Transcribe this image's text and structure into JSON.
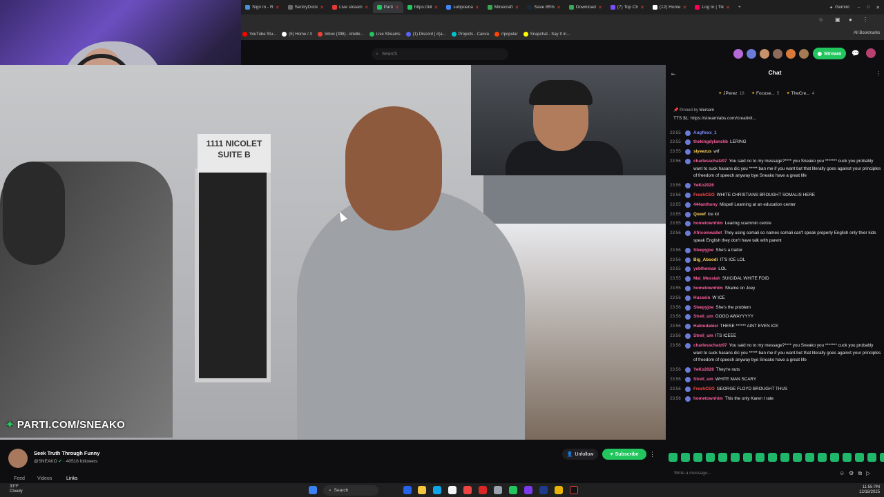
{
  "browser": {
    "tabs": [
      {
        "label": "Sign In - R",
        "color": "#4a90d9"
      },
      {
        "label": "SentryDock",
        "color": "#6b6b6b"
      },
      {
        "label": "Live stream",
        "color": "#e53935"
      },
      {
        "label": "Parti",
        "color": "#22c55e",
        "active": true
      },
      {
        "label": "https://kil",
        "color": "#22c55e"
      },
      {
        "label": "subpoena",
        "color": "#4285f4"
      },
      {
        "label": "Minecraft",
        "color": "#3aa757"
      },
      {
        "label": "Save 85%",
        "color": "#1b2838"
      },
      {
        "label": "Download",
        "color": "#3aa757"
      },
      {
        "label": "(7) Top Ch",
        "color": "#7c4dff"
      },
      {
        "label": "(12) Home",
        "color": "#ffffff"
      },
      {
        "label": "Log In | Tik",
        "color": "#ff0050"
      }
    ],
    "new_tab_symbol": "+",
    "gemini_label": "Gemini",
    "bookmarks": [
      {
        "label": "YouTube Stu...",
        "color": "#ff0000"
      },
      {
        "label": "(5) Home / X",
        "color": "#ffffff"
      },
      {
        "label": "Inbox (398) - khelle...",
        "color": "#ea4335"
      },
      {
        "label": "Live Streams",
        "color": "#22c55e"
      },
      {
        "label": "(1) Discord | #(a...",
        "color": "#5865f2"
      },
      {
        "label": "Projects - Canva",
        "color": "#00c4cc"
      },
      {
        "label": "r/popular",
        "color": "#ff4500"
      },
      {
        "label": "Snapchat - Say It In...",
        "color": "#fffc00"
      }
    ],
    "all_bookmarks": "All Bookmarks"
  },
  "site": {
    "search_placeholder": "Search",
    "stream_button": "Stream"
  },
  "video": {
    "watermark": "PARTI.COM/SNEAKO",
    "sign_text": "1111 NICOLET SUITE B"
  },
  "stream": {
    "title": "Seek Truth Through Funny",
    "channel": "@SNEAKO",
    "followers": "40516 followers",
    "tabs": [
      "Feed",
      "Videos",
      "Links"
    ],
    "unfollow": "Unfollow",
    "subscribe": "Subscribe"
  },
  "chat": {
    "title": "Chat",
    "leaderboard": [
      {
        "name": "JPerez",
        "count": "18"
      },
      {
        "name": "Focuse...",
        "count": "5"
      },
      {
        "name": "TheCre...",
        "count": "4"
      }
    ],
    "pinned_by": "Pinned by",
    "pinned_user": "Mersem",
    "pinned_text": "TTS $1: https://streamlabs.com/creativit...",
    "input_placeholder": "Write a message...",
    "messages": [
      {
        "ts": "23:55",
        "user": "Augflexx_1",
        "color": "#7c8cff",
        "text": ""
      },
      {
        "ts": "23:55",
        "user": "thekingdylanshb",
        "color": "#ff5f9e",
        "text": "LERING"
      },
      {
        "ts": "23:55",
        "user": "slyeezus",
        "color": "#ffd25a",
        "text": "wtf"
      },
      {
        "ts": "23:56",
        "user": "charlesschatz97",
        "color": "#ff5f9e",
        "text": "You said no to my message?**** you Sneako you ******* cuck you probably want to suck hasans dic you ***** ban me if you want but that literally goes against your principles of freedom of speech anyway bye Sneako have a great life"
      },
      {
        "ts": "23:56",
        "user": "YeKo2026",
        "color": "#ff5f9e",
        "text": ""
      },
      {
        "ts": "23:56",
        "user": "FreshCEO",
        "color": "#ff4a4a",
        "text": "WHITE CHRISTIANS BROUGHT SOMALIS HERE"
      },
      {
        "ts": "23:55",
        "user": "444anthony",
        "color": "#ff5f9e",
        "text": "Mispell Learning at an education center"
      },
      {
        "ts": "23:55",
        "user": "Queef",
        "color": "#ffd25a",
        "text": "ice lol"
      },
      {
        "ts": "23:55",
        "user": "hometownhim",
        "color": "#ff5f9e",
        "text": "Learing scammin centre"
      },
      {
        "ts": "23:56",
        "user": "Africoinwallet",
        "color": "#ff5f9e",
        "text": "They using somali so names somali can't speak properly English only thier kids speak English they don't have talk with parent"
      },
      {
        "ts": "23:56",
        "user": "Sleepyjoe",
        "color": "#ff5f9e",
        "text": "She's a traitor"
      },
      {
        "ts": "23:56",
        "user": "Big_Aboodi",
        "color": "#ffd25a",
        "text": "IT'S ICE LOL"
      },
      {
        "ts": "23:55",
        "user": "yebtheman",
        "color": "#ff5f9e",
        "text": "LOL"
      },
      {
        "ts": "23:55",
        "user": "Mal_Messiah",
        "color": "#ff5f9e",
        "text": "SUICIDAL WHITE FOID"
      },
      {
        "ts": "23:55",
        "user": "hometownhim",
        "color": "#ff5f9e",
        "text": "Shame on Joey"
      },
      {
        "ts": "23:56",
        "user": "Hussein",
        "color": "#ff5f9e",
        "text": "W ICE"
      },
      {
        "ts": "23:56",
        "user": "Sleepyjoe",
        "color": "#ff5f9e",
        "text": "She's the problem"
      },
      {
        "ts": "23:56",
        "user": "Streil_um",
        "color": "#ff5f9e",
        "text": "GOOO AWAYYYYY"
      },
      {
        "ts": "23:56",
        "user": "Hablodabiel",
        "color": "#ff5f9e",
        "text": "THESE ****** AINT EVEN ICE"
      },
      {
        "ts": "23:56",
        "user": "Streil_um",
        "color": "#ff5f9e",
        "text": "ITS ICEEE"
      },
      {
        "ts": "23:56",
        "user": "charlesschatz97",
        "color": "#ff5f9e",
        "text": "You said no to my message?**** you Sneako you ******* cuck you probably want to suck hasans dic you ***** ban me if you want but that literally goes against your principles of freedom of speech anyway bye Sneako have a great life"
      },
      {
        "ts": "23:56",
        "user": "YeKo2026",
        "color": "#ff5f9e",
        "text": "They're nuts"
      },
      {
        "ts": "23:56",
        "user": "Streil_um",
        "color": "#ff5f9e",
        "text": "WHITE MAN SCARY"
      },
      {
        "ts": "23:56",
        "user": "FreshCEO",
        "color": "#ff4a4a",
        "text": "GEORGE FLOYD BROUGHT THUS"
      },
      {
        "ts": "23:56",
        "user": "hometownhim",
        "color": "#ff5f9e",
        "text": "This the only Karen I rate"
      }
    ]
  },
  "taskbar": {
    "weather_temp": "33°F",
    "weather_desc": "Cloudy",
    "search": "Search",
    "time": "11:55 PM",
    "date": "12/18/2025"
  }
}
